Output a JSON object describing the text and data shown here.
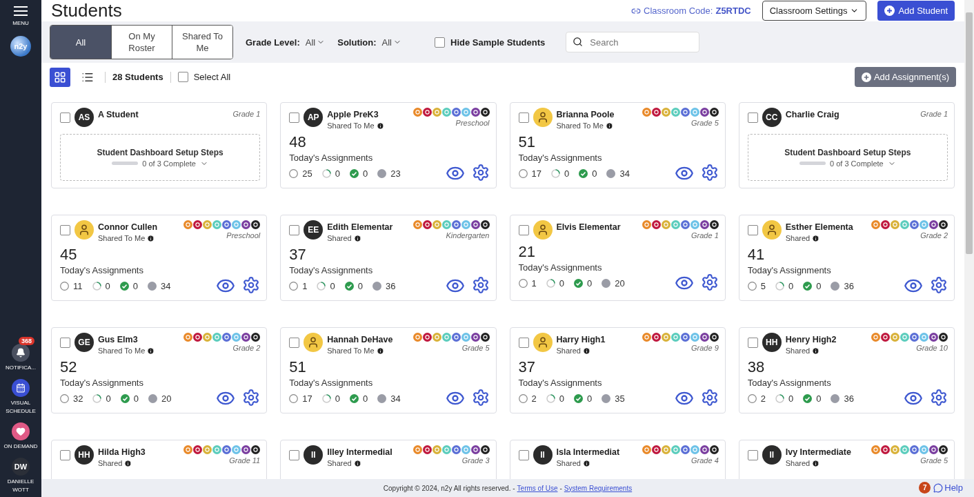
{
  "sidebar": {
    "menu_label": "MENU",
    "logo_text": "n2y",
    "items": [
      {
        "kind": "notifications",
        "label": "NOTIFICA...",
        "badge": "368"
      },
      {
        "kind": "schedule",
        "label": "VISUAL SCHEDULE"
      },
      {
        "kind": "on_demand",
        "label": "ON DEMAND"
      },
      {
        "kind": "user",
        "initials": "DW",
        "label": "DANIELLE WOTT"
      }
    ]
  },
  "header": {
    "title": "Students",
    "classroom_code_label": "Classroom Code:",
    "classroom_code": "Z5RTDC",
    "settings_button": "Classroom Settings",
    "add_button": "Add Student"
  },
  "filters": {
    "segments": [
      {
        "label": "All",
        "selected": true
      },
      {
        "label": "On My Roster",
        "selected": false
      },
      {
        "label": "Shared To Me",
        "selected": false
      }
    ],
    "dropdowns": [
      {
        "label": "Grade Level:",
        "value": "All"
      },
      {
        "label": "Solution:",
        "value": "All"
      }
    ],
    "hide_sample": {
      "label": "Hide Sample Students",
      "checked": false
    },
    "search": {
      "placeholder": "Search"
    }
  },
  "toolbar": {
    "views": [
      {
        "kind": "grid",
        "selected": true
      },
      {
        "kind": "list",
        "selected": false
      }
    ],
    "count": "28 Students",
    "select_all": {
      "label": "Select All",
      "checked": false
    },
    "add_assignments": "Add Assignment(s)"
  },
  "cards": [
    {
      "kind": "setup",
      "name": "A Student",
      "checked": false,
      "avatar": {
        "kind": "initials",
        "initials": "AS"
      },
      "grade": "Grade 1",
      "setup": {
        "title": "Student Dashboard Setup Steps",
        "progress": "0 of 3 Complete",
        "level": 0
      }
    },
    {
      "kind": "stats",
      "name": "Apple PreK3",
      "checked": false,
      "avatar": {
        "kind": "initials",
        "initials": "AP"
      },
      "shared": "Shared To Me",
      "grade": "Preschool",
      "total": "48",
      "assignments_label": "Today's Assignments",
      "stats": [
        {
          "kind": "open",
          "count": "25"
        },
        {
          "kind": "progress",
          "count": "0"
        },
        {
          "kind": "done",
          "count": "0"
        },
        {
          "kind": "other",
          "count": "23"
        }
      ]
    },
    {
      "kind": "stats",
      "name": "Brianna Poole",
      "checked": false,
      "avatar": {
        "kind": "picture"
      },
      "shared": "Shared To Me",
      "grade": "Grade 5",
      "total": "51",
      "assignments_label": "Today's Assignments",
      "stats": [
        {
          "kind": "open",
          "count": "17"
        },
        {
          "kind": "progress",
          "count": "0"
        },
        {
          "kind": "done",
          "count": "0"
        },
        {
          "kind": "other",
          "count": "34"
        }
      ]
    },
    {
      "kind": "setup",
      "name": "Charlie Craig",
      "checked": false,
      "avatar": {
        "kind": "initials",
        "initials": "CC"
      },
      "grade": "Grade 1",
      "setup": {
        "title": "Student Dashboard Setup Steps",
        "progress": "0 of 3 Complete",
        "level": 0
      }
    },
    {
      "kind": "stats",
      "name": "Connor Cullen",
      "checked": false,
      "avatar": {
        "kind": "picture"
      },
      "shared": "Shared To Me",
      "grade": "Preschool",
      "total": "45",
      "assignments_label": "Today's Assignments",
      "stats": [
        {
          "kind": "open",
          "count": "11"
        },
        {
          "kind": "progress",
          "count": "0"
        },
        {
          "kind": "done",
          "count": "0"
        },
        {
          "kind": "other",
          "count": "34"
        }
      ]
    },
    {
      "kind": "stats",
      "name": "Edith Elementar",
      "checked": false,
      "avatar": {
        "kind": "initials",
        "initials": "EE"
      },
      "shared": "Shared",
      "grade": "Kindergarten",
      "total": "37",
      "assignments_label": "Today's Assignments",
      "stats": [
        {
          "kind": "open",
          "count": "1"
        },
        {
          "kind": "progress",
          "count": "0"
        },
        {
          "kind": "done",
          "count": "0"
        },
        {
          "kind": "other",
          "count": "36"
        }
      ]
    },
    {
      "kind": "stats",
      "name": "Elvis Elementar",
      "checked": false,
      "avatar": {
        "kind": "picture"
      },
      "grade": "Grade 1",
      "total": "21",
      "assignments_label": "Today's Assignments",
      "stats": [
        {
          "kind": "open",
          "count": "1"
        },
        {
          "kind": "progress",
          "count": "0"
        },
        {
          "kind": "done",
          "count": "0"
        },
        {
          "kind": "other",
          "count": "20"
        }
      ]
    },
    {
      "kind": "stats",
      "name": "Esther Elementa",
      "checked": false,
      "avatar": {
        "kind": "picture"
      },
      "shared": "Shared",
      "grade": "Grade 2",
      "total": "41",
      "assignments_label": "Today's Assignments",
      "stats": [
        {
          "kind": "open",
          "count": "5"
        },
        {
          "kind": "progress",
          "count": "0"
        },
        {
          "kind": "done",
          "count": "0"
        },
        {
          "kind": "other",
          "count": "36"
        }
      ]
    },
    {
      "kind": "stats",
      "name": "Gus Elm3",
      "checked": false,
      "avatar": {
        "kind": "initials",
        "initials": "GE"
      },
      "shared": "Shared To Me",
      "grade": "Grade 2",
      "total": "52",
      "assignments_label": "Today's Assignments",
      "stats": [
        {
          "kind": "open",
          "count": "32"
        },
        {
          "kind": "progress",
          "count": "0"
        },
        {
          "kind": "done",
          "count": "0"
        },
        {
          "kind": "other",
          "count": "20"
        }
      ]
    },
    {
      "kind": "stats",
      "name": "Hannah DeHave",
      "checked": false,
      "avatar": {
        "kind": "picture"
      },
      "shared": "Shared To Me",
      "grade": "Grade 5",
      "total": "51",
      "assignments_label": "Today's Assignments",
      "stats": [
        {
          "kind": "open",
          "count": "17"
        },
        {
          "kind": "progress",
          "count": "0"
        },
        {
          "kind": "done",
          "count": "0"
        },
        {
          "kind": "other",
          "count": "34"
        }
      ]
    },
    {
      "kind": "stats",
      "name": "Harry High1",
      "checked": false,
      "avatar": {
        "kind": "picture"
      },
      "shared": "Shared",
      "grade": "Grade 9",
      "total": "37",
      "assignments_label": "Today's Assignments",
      "stats": [
        {
          "kind": "open",
          "count": "2"
        },
        {
          "kind": "progress",
          "count": "0"
        },
        {
          "kind": "done",
          "count": "0"
        },
        {
          "kind": "other",
          "count": "35"
        }
      ]
    },
    {
      "kind": "stats",
      "name": "Henry High2",
      "checked": false,
      "avatar": {
        "kind": "initials",
        "initials": "HH"
      },
      "shared": "Shared",
      "grade": "Grade 10",
      "total": "38",
      "assignments_label": "Today's Assignments",
      "stats": [
        {
          "kind": "open",
          "count": "2"
        },
        {
          "kind": "progress",
          "count": "0"
        },
        {
          "kind": "done",
          "count": "0"
        },
        {
          "kind": "other",
          "count": "36"
        }
      ]
    },
    {
      "kind": "stats",
      "name": "Hilda High3",
      "checked": false,
      "avatar": {
        "kind": "initials",
        "initials": "HH"
      },
      "shared": "Shared",
      "grade": "Grade 11"
    },
    {
      "kind": "stats",
      "name": "Illey Intermedial",
      "checked": false,
      "avatar": {
        "kind": "initials",
        "initials": "II"
      },
      "shared": "Shared",
      "grade": "Grade 3"
    },
    {
      "kind": "stats",
      "name": "Isla Intermediat",
      "checked": false,
      "avatar": {
        "kind": "initials",
        "initials": "II"
      },
      "shared": "Shared",
      "grade": "Grade 4"
    },
    {
      "kind": "stats",
      "name": "Ivy Intermediate",
      "checked": false,
      "avatar": {
        "kind": "initials",
        "initials": "II"
      },
      "shared": "Shared",
      "grade": "Grade 5"
    }
  ],
  "footer": {
    "copyright": "Copyright © 2024, n2y All rights reserved. -",
    "links": [
      "Terms of Use",
      "System Requirements"
    ],
    "separator": "-",
    "help_badge": "7",
    "help": "Help"
  }
}
